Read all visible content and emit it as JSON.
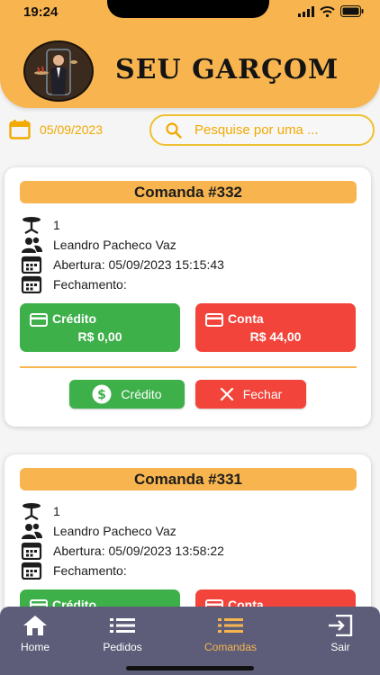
{
  "status_bar": {
    "time": "19:24"
  },
  "header": {
    "brand": "SEU GARÇOM"
  },
  "filter": {
    "date": "05/09/2023",
    "search_placeholder": "Pesquise por uma ..."
  },
  "comandas": [
    {
      "title": "Comanda #332",
      "table": "1",
      "customer": "Leandro Pacheco Vaz",
      "opened": "Abertura: 05/09/2023 15:15:43",
      "closed": "Fechamento:",
      "credit_label": "Crédito",
      "credit_value": "R$ 0,00",
      "account_label": "Conta",
      "account_value": "R$ 44,00",
      "credit_button": "Crédito",
      "close_button": "Fechar"
    },
    {
      "title": "Comanda #331",
      "table": "1",
      "customer": "Leandro Pacheco Vaz",
      "opened": "Abertura: 05/09/2023 13:58:22",
      "closed": "Fechamento:",
      "credit_label": "Crédito",
      "account_label": "Conta"
    }
  ],
  "nav": {
    "items": [
      {
        "label": "Home",
        "icon": "home-icon"
      },
      {
        "label": "Pedidos",
        "icon": "list-icon"
      },
      {
        "label": "Comandas",
        "icon": "list-icon"
      },
      {
        "label": "Sair",
        "icon": "logout-icon"
      }
    ],
    "active": "Comandas"
  },
  "colors": {
    "primary": "#f8b54f",
    "success": "#3db04a",
    "danger": "#f2443a",
    "nav": "#5d5d7a"
  }
}
